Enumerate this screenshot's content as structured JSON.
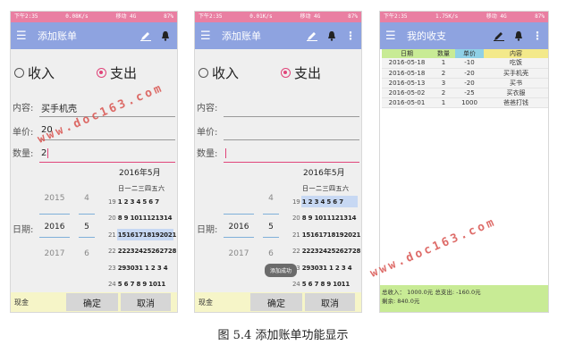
{
  "status": {
    "time": "下午2:35",
    "net1": "0.08K/s",
    "net2": "0.01K/s",
    "net3": "1.75K/s",
    "carrier": "移动 4G",
    "battery": "87%"
  },
  "screens": {
    "add1": {
      "title": "添加账单"
    },
    "add2": {
      "title": "添加账单"
    },
    "list": {
      "title": "我的收支"
    }
  },
  "form": {
    "income": "收入",
    "expense": "支出",
    "content_label": "内容:",
    "price_label": "单价:",
    "qty_label": "数量:",
    "date_label": "日期:",
    "content_value": "买手机壳",
    "price_value": "20",
    "qty_value": "2"
  },
  "date_picker": {
    "years": [
      "2015",
      "2016",
      "2017"
    ],
    "months": [
      "4",
      "5",
      "6"
    ]
  },
  "calendar": {
    "title": "2016年5月",
    "weekdays": "日一二三四五六",
    "rows": [
      {
        "wk": "19",
        "days": "1 2 3 4 5 6 7"
      },
      {
        "wk": "20",
        "days": "8 9 1011121314"
      },
      {
        "wk": "21",
        "days": "15161718192021"
      },
      {
        "wk": "22",
        "days": "22232425262728"
      },
      {
        "wk": "23",
        "days": "293031 1 2 3 4"
      },
      {
        "wk": "24",
        "days": "5 6 7 8 9 1011"
      }
    ]
  },
  "bottom": {
    "category": "现金",
    "ok": "确定",
    "cancel": "取消"
  },
  "toast": "添加成功",
  "table": {
    "headers": [
      "日期",
      "数量",
      "单价",
      "内容"
    ],
    "rows": [
      [
        "2016-05-18",
        "1",
        "-10",
        "吃饭"
      ],
      [
        "2016-05-18",
        "2",
        "-20",
        "买手机壳"
      ],
      [
        "2016-05-13",
        "3",
        "-20",
        "买书"
      ],
      [
        "2016-05-02",
        "2",
        "-25",
        "买衣服"
      ],
      [
        "2016-05-01",
        "1",
        "1000",
        "爸爸打钱"
      ]
    ]
  },
  "summary": {
    "line1": "总收入： 1000.0元    总支出: -160.0元",
    "line2": "剩余:  840.0元"
  },
  "watermark": "www.doc163.com",
  "caption": "图 5.4  添加账单功能显示",
  "colors": {
    "status": "#e97fa2",
    "toolbar": "#8ea3e0",
    "accent": "#e0457a",
    "summary": "#c8eb95",
    "bottom": "#f6f5c8"
  }
}
